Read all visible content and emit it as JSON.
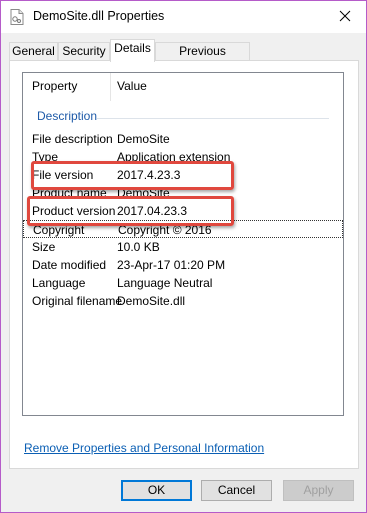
{
  "window": {
    "title": "DemoSite.dll Properties"
  },
  "tabs": [
    {
      "label": "General"
    },
    {
      "label": "Security"
    },
    {
      "label": "Details"
    },
    {
      "label": "Previous Versions"
    }
  ],
  "details": {
    "columns": {
      "property": "Property",
      "value": "Value"
    },
    "group_label": "Description",
    "rows": [
      {
        "name": "File description",
        "value": "DemoSite"
      },
      {
        "name": "Type",
        "value": "Application extension"
      },
      {
        "name": "File version",
        "value": "2017.4.23.3"
      },
      {
        "name": "Product name",
        "value": "DemoSite"
      },
      {
        "name": "Product version",
        "value": "2017.04.23.3"
      },
      {
        "name": "Copyright",
        "value": "Copyright ©  2016"
      },
      {
        "name": "Size",
        "value": "10.0 KB"
      },
      {
        "name": "Date modified",
        "value": "23-Apr-17 01:20 PM"
      },
      {
        "name": "Language",
        "value": "Language Neutral"
      },
      {
        "name": "Original filename",
        "value": "DemoSite.dll"
      }
    ]
  },
  "link_text": "Remove Properties and Personal Information",
  "buttons": {
    "ok": "OK",
    "cancel": "Cancel",
    "apply": "Apply"
  },
  "colors": {
    "callout": "#e0483e",
    "group_text": "#1e5aa8",
    "link": "#0b5fb4",
    "window_border": "#b55bc9"
  }
}
